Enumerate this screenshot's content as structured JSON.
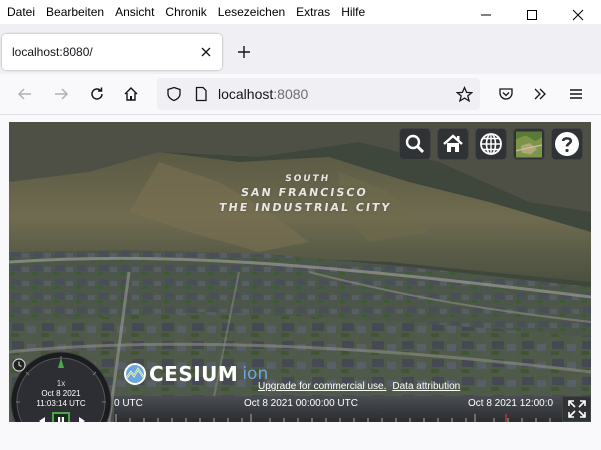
{
  "menubar": {
    "items": [
      {
        "label": "Datei"
      },
      {
        "label": "Bearbeiten"
      },
      {
        "label": "Ansicht"
      },
      {
        "label": "Chronik"
      },
      {
        "label": "Lesezeichen"
      },
      {
        "label": "Extras"
      },
      {
        "label": "Hilfe"
      }
    ],
    "window_controls": [
      "minimize-icon",
      "maximize-icon",
      "close-icon"
    ]
  },
  "tabs": [
    {
      "title": "localhost:8080/",
      "active": true
    }
  ],
  "new_tab_icon": "plus-icon",
  "navigation": {
    "back_icon": "arrow-left-icon",
    "forward_icon": "arrow-right-icon",
    "reload_icon": "reload-icon",
    "home_icon": "home-icon"
  },
  "urlbar": {
    "host": "localhost",
    "port": ":8080",
    "shield_icon": "shield-icon",
    "page_icon": "page-icon",
    "bookmark_icon": "star-icon"
  },
  "toolbar_right": [
    "pocket-icon",
    "overflow-icon",
    "hamburger-menu-icon"
  ],
  "cesium": {
    "toolbar": [
      "search-icon",
      "home-icon",
      "globe-icon",
      "imagery-icon",
      "help-icon"
    ],
    "hill_text": {
      "line1": "SOUTH",
      "line2": "SAN FRANCISCO",
      "line3": "THE INDUSTRIAL CITY"
    },
    "logo": {
      "main": "CESIUM",
      "suffix": "ion"
    },
    "credits": {
      "upgrade": "Upgrade for commercial use.",
      "attribution": "Data attribution"
    },
    "timeline": {
      "label_left": "0 UTC",
      "label_mid": "Oct 8 2021 00:00:00 UTC",
      "label_right": "Oct 8 2021 12:00:0"
    },
    "animation": {
      "speed": "1x",
      "date": "Oct 8 2021",
      "time": "11:03:14 UTC"
    },
    "colors": {
      "accent": "#6ca6e0",
      "widget_bg": "#303336",
      "play_green": "#4ca64c"
    }
  }
}
